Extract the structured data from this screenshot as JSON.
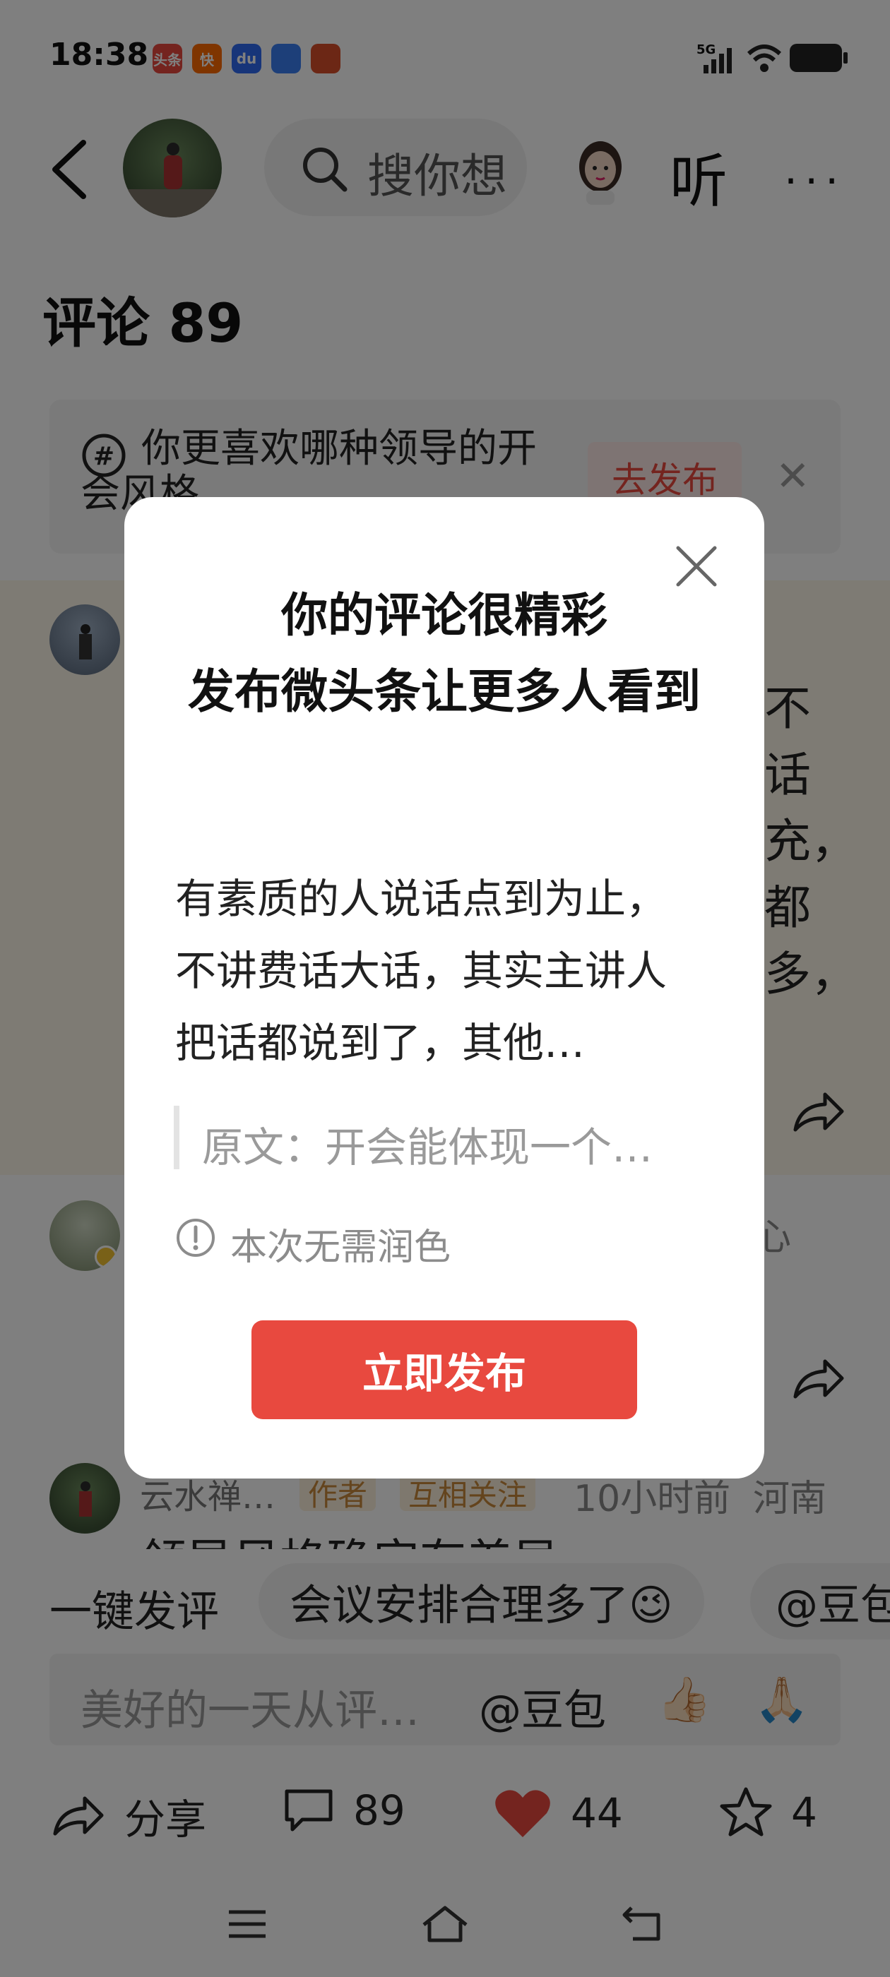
{
  "status_bar": {
    "time": "18:38",
    "apps": [
      {
        "name": "toutiao-icon",
        "label": "头条",
        "color": "#e8493f"
      },
      {
        "name": "kuaishou-icon",
        "label": "快",
        "color": "#ff6a00"
      },
      {
        "name": "baidu-icon",
        "label": "du",
        "color": "#2f6bf2"
      },
      {
        "name": "search-app-icon",
        "label": "",
        "color": "#3a7ff2"
      },
      {
        "name": "game-icon",
        "label": "",
        "color": "#d94f2b"
      }
    ],
    "network": "5G"
  },
  "header": {
    "search_placeholder": "搜你想",
    "listen_label": "听",
    "more_label": "···"
  },
  "comments_title": "评论 89",
  "topic": {
    "text": "你更喜欢哪种领导的开会风格",
    "publish_label": "去发布",
    "close_label": "✕"
  },
  "background_fragments": [
    "不",
    "话",
    "充，",
    "都",
    "多，",
    "心"
  ],
  "comment3": {
    "name": "云水禅…",
    "tag_author": "作者",
    "tag_mutual": "互相关注",
    "time": "10小时前",
    "location": "河南",
    "body": "领导风格确实有差异"
  },
  "quick_reply": {
    "label": "一键发评",
    "chips": [
      "会议安排合理多了😉",
      "@豆包"
    ]
  },
  "input_bar": {
    "placeholder": "美好的一天从评…",
    "doubao": "@豆包",
    "emoji1": "👍🏻",
    "emoji2": "🙏🏻"
  },
  "actions": {
    "share": "分享",
    "comments": "89",
    "likes": "44",
    "favorites": "4",
    "accent": "#e8493f"
  },
  "modal": {
    "title_line1": "你的评论很精彩",
    "title_line2": "发布微头条让更多人看到",
    "comment_text": "有素质的人说话点到为止，不讲费话大话，其实主讲人把话都说到了，其他…",
    "quote": "原文：开会能体现一个…",
    "info": "本次无需润色",
    "button": "立即发布",
    "button_color": "#e8493f"
  }
}
